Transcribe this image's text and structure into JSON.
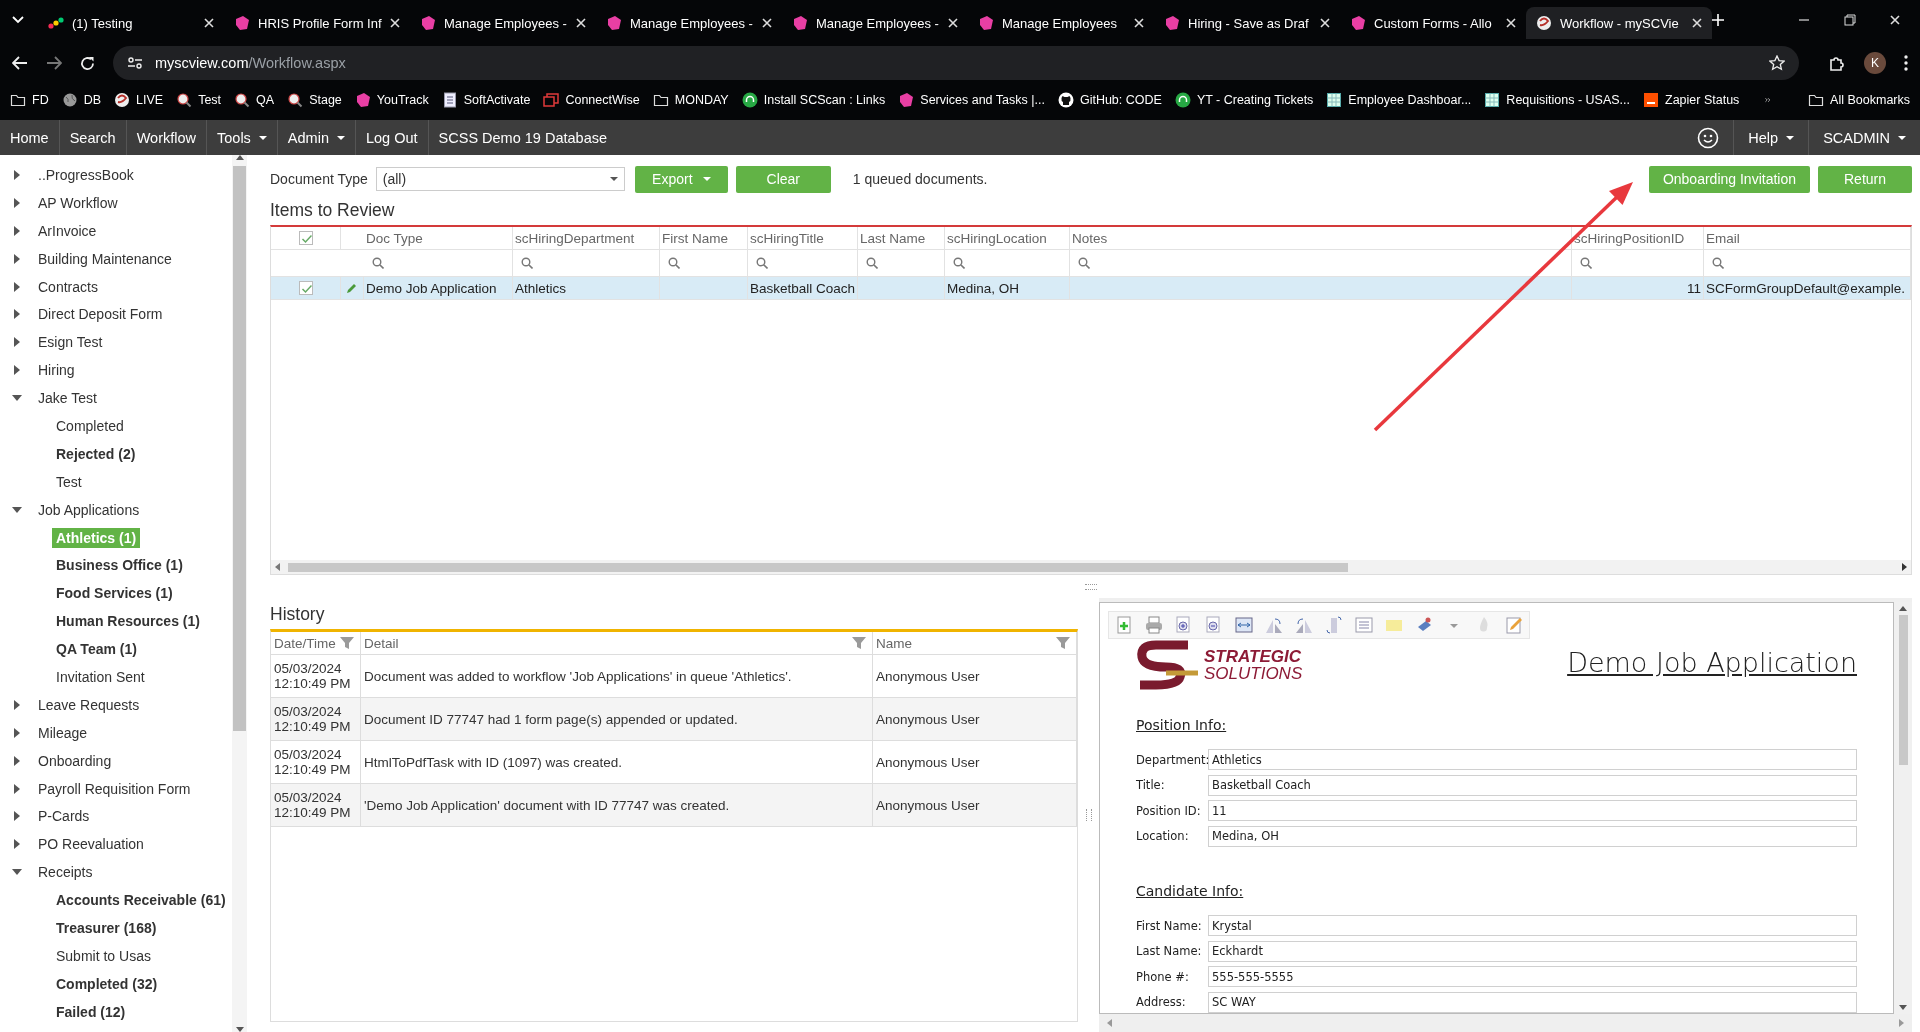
{
  "browser": {
    "tabs": [
      {
        "title": "(1) Testing",
        "kind": "colorful",
        "selected": false
      },
      {
        "title": "HRIS Profile Form Inf",
        "kind": "brand",
        "selected": false
      },
      {
        "title": "Manage Employees -",
        "kind": "brand",
        "selected": false
      },
      {
        "title": "Manage Employees -",
        "kind": "brand",
        "selected": false
      },
      {
        "title": "Manage Employees -",
        "kind": "brand",
        "selected": false
      },
      {
        "title": "Manage Employees",
        "kind": "brand",
        "selected": false
      },
      {
        "title": "Hiring - Save as Draf",
        "kind": "brand",
        "selected": false
      },
      {
        "title": "Custom Forms - Allo",
        "kind": "brand",
        "selected": false
      },
      {
        "title": "Workflow - mySCVie",
        "kind": "app",
        "selected": true
      }
    ],
    "url": {
      "host": "myscview.com",
      "path": "/Workflow.aspx"
    },
    "profile": "K",
    "bookmarks": [
      {
        "label": "FD",
        "kind": "folder"
      },
      {
        "label": "DB",
        "kind": "globe"
      },
      {
        "label": "LIVE",
        "kind": "app"
      },
      {
        "label": "Test",
        "kind": "magnifier"
      },
      {
        "label": "QA",
        "kind": "magnifier"
      },
      {
        "label": "Stage",
        "kind": "magnifier"
      },
      {
        "label": "YouTrack",
        "kind": "brand"
      },
      {
        "label": "SoftActivate",
        "kind": "page"
      },
      {
        "label": "ConnectWise",
        "kind": "windows"
      },
      {
        "label": "MONDAY",
        "kind": "folder"
      },
      {
        "label": "Install SCScan : Links",
        "kind": "headset"
      },
      {
        "label": "Services and Tasks |...",
        "kind": "brand"
      },
      {
        "label": "GitHub: CODE",
        "kind": "github"
      },
      {
        "label": "YT - Creating Tickets",
        "kind": "headset"
      },
      {
        "label": "Employee Dashboar...",
        "kind": "grid"
      },
      {
        "label": "Requisitions - USAS...",
        "kind": "grid"
      },
      {
        "label": "Zapier Status",
        "kind": "square"
      }
    ],
    "all_bookmarks": "All Bookmarks"
  },
  "app_nav": {
    "items": [
      {
        "label": "Home",
        "dropdown": false
      },
      {
        "label": "Search",
        "dropdown": false
      },
      {
        "label": "Workflow",
        "dropdown": false
      },
      {
        "label": "Tools",
        "dropdown": true
      },
      {
        "label": "Admin",
        "dropdown": true
      },
      {
        "label": "Log Out",
        "dropdown": false
      }
    ],
    "database": "SCSS Demo 19 Database",
    "right": [
      {
        "label": "Help",
        "dropdown": true
      },
      {
        "label": "SCADMIN",
        "dropdown": true
      }
    ]
  },
  "sidebar": {
    "items": [
      {
        "label": "..ProgressBook",
        "expanded": false,
        "selected": false
      },
      {
        "label": "AP Workflow",
        "expanded": false,
        "selected": false
      },
      {
        "label": "ArInvoice",
        "expanded": false,
        "selected": false
      },
      {
        "label": "Building Maintenance",
        "expanded": false,
        "selected": false
      },
      {
        "label": "Contracts",
        "expanded": false,
        "selected": false
      },
      {
        "label": "Direct Deposit Form",
        "expanded": false,
        "selected": false
      },
      {
        "label": "Esign Test",
        "expanded": false,
        "selected": false
      },
      {
        "label": "Hiring",
        "expanded": false,
        "selected": false
      },
      {
        "label": "Jake Test",
        "expanded": true,
        "selected": false,
        "children": [
          {
            "label": "Completed",
            "unread": false,
            "selected": false
          },
          {
            "label": "Rejected (2)",
            "unread": true,
            "selected": false
          },
          {
            "label": "Test",
            "unread": false,
            "selected": false
          }
        ]
      },
      {
        "label": "Job Applications",
        "expanded": true,
        "selected": false,
        "children": [
          {
            "label": "Athletics (1)",
            "unread": true,
            "selected": true
          },
          {
            "label": "Business Office (1)",
            "unread": true,
            "selected": false
          },
          {
            "label": "Food Services (1)",
            "unread": true,
            "selected": false
          },
          {
            "label": "Human Resources (1)",
            "unread": true,
            "selected": false
          },
          {
            "label": "QA Team (1)",
            "unread": true,
            "selected": false
          },
          {
            "label": "Invitation Sent",
            "unread": false,
            "selected": false
          }
        ]
      },
      {
        "label": "Leave Requests",
        "expanded": false,
        "selected": false
      },
      {
        "label": "Mileage",
        "expanded": false,
        "selected": false
      },
      {
        "label": "Onboarding",
        "expanded": false,
        "selected": false
      },
      {
        "label": "Payroll Requisition Form",
        "expanded": false,
        "selected": false
      },
      {
        "label": "P-Cards",
        "expanded": false,
        "selected": false
      },
      {
        "label": "PO Reevaluation",
        "expanded": false,
        "selected": false
      },
      {
        "label": "Receipts",
        "expanded": true,
        "selected": false,
        "children": [
          {
            "label": "Accounts Receivable (61)",
            "unread": true,
            "selected": false
          },
          {
            "label": "Treasurer (168)",
            "unread": true,
            "selected": false
          },
          {
            "label": "Submit to Usas",
            "unread": false,
            "selected": false
          },
          {
            "label": "Completed (32)",
            "unread": true,
            "selected": false
          },
          {
            "label": "Failed (12)",
            "unread": true,
            "selected": false
          }
        ]
      }
    ]
  },
  "review": {
    "toolbar": {
      "document_type": {
        "label": "Document Type",
        "value": "(all)"
      },
      "buttons": [
        {
          "label": "Export",
          "dropdown": true
        },
        {
          "label": "Clear",
          "dropdown": false
        }
      ],
      "queue_text": "1 queued documents.",
      "right_buttons": [
        "Onboarding Invitation",
        "Return"
      ]
    },
    "title": "Items to Review",
    "grid": {
      "header_checked": true,
      "columns": [
        {
          "label": "Doc Type",
          "kind": "text"
        },
        {
          "label": "scHiringDepartment",
          "kind": "text"
        },
        {
          "label": "First Name",
          "kind": "text"
        },
        {
          "label": "scHiringTitle",
          "kind": "text"
        },
        {
          "label": "Last Name",
          "kind": "text"
        },
        {
          "label": "scHiringLocation",
          "kind": "text"
        },
        {
          "label": "Notes",
          "kind": "text"
        },
        {
          "label": "scHiringPositionID",
          "kind": "number"
        },
        {
          "label": "Email",
          "kind": "text"
        }
      ],
      "rows": [
        {
          "checked": true,
          "selected": true,
          "cells": [
            "Demo Job Application",
            "Athletics",
            null,
            "Basketball Coach",
            null,
            "Medina, OH",
            null,
            "11",
            "SCFormGroupDefault@example."
          ]
        }
      ]
    }
  },
  "history": {
    "title": "History",
    "columns": [
      "Date/Time",
      "Detail",
      "Name"
    ],
    "rows": [
      {
        "datetime": "05/03/2024 12:10:49 PM",
        "detail": "Document was added to workflow 'Job Applications' in queue 'Athletics'.",
        "name": "Anonymous User"
      },
      {
        "datetime": "05/03/2024 12:10:49 PM",
        "detail": "Document ID 77747 had 1 form page(s) appended or updated.",
        "name": "Anonymous User"
      },
      {
        "datetime": "05/03/2024 12:10:49 PM",
        "detail": "HtmlToPdfTask with ID (1097) was created.",
        "name": "Anonymous User"
      },
      {
        "datetime": "05/03/2024 12:10:49 PM",
        "detail": "'Demo Job Application' document with ID 77747 was created.",
        "name": "Anonymous User"
      }
    ]
  },
  "preview": {
    "logo": [
      "STRATEGIC",
      "SOLUTIONS"
    ],
    "title": "Demo Job Application",
    "sections": [
      {
        "heading": "Position Info:",
        "fields": [
          {
            "label": "Department:",
            "value": "Athletics"
          },
          {
            "label": "Title:",
            "value": "Basketball Coach"
          },
          {
            "label": "Position ID:",
            "value": "11"
          },
          {
            "label": "Location:",
            "value": "Medina, OH"
          }
        ]
      },
      {
        "heading": "Candidate Info:",
        "fields": [
          {
            "label": "First Name:",
            "value": "Krystal"
          },
          {
            "label": "Last Name:",
            "value": "Eckhardt"
          },
          {
            "label": "Phone #:",
            "value": "555-555-5555"
          },
          {
            "label": "Address:",
            "value": "SC WAY"
          }
        ]
      }
    ]
  }
}
